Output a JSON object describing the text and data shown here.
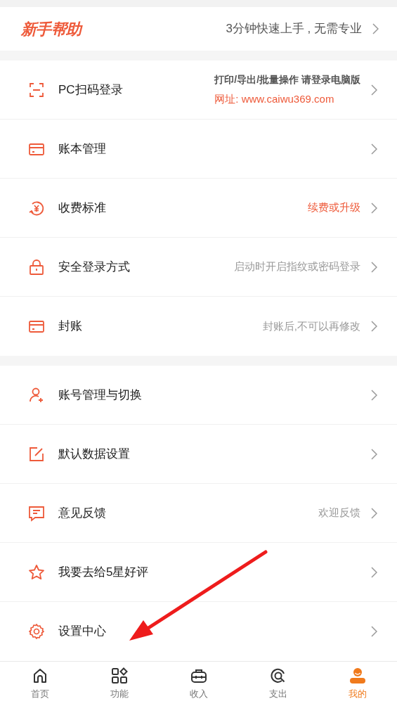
{
  "help_banner": {
    "title": "新手帮助",
    "subtitle": "3分钟快速上手 , 无需专业"
  },
  "sections": [
    {
      "items": [
        {
          "label": "PC扫码登录",
          "hints": [
            {
              "text": "打印/导出/批量操作 请登录电脑版",
              "kind": "bold"
            },
            {
              "text": "网址: www.caiwu369.com",
              "kind": "accent"
            }
          ]
        },
        {
          "label": "账本管理"
        },
        {
          "label": "收费标准",
          "hints": [
            {
              "text": "续费或升级",
              "kind": "accent"
            }
          ]
        },
        {
          "label": "安全登录方式",
          "hints": [
            {
              "text": "启动时开启指纹或密码登录",
              "kind": "muted"
            }
          ]
        },
        {
          "label": "封账",
          "hints": [
            {
              "text": "封账后,不可以再修改",
              "kind": "muted"
            }
          ]
        }
      ]
    },
    {
      "items": [
        {
          "label": "账号管理与切换"
        },
        {
          "label": "默认数据设置"
        },
        {
          "label": "意见反馈",
          "hints": [
            {
              "text": "欢迎反馈",
              "kind": "muted"
            }
          ]
        },
        {
          "label": "我要去给5星好评"
        },
        {
          "label": "设置中心"
        }
      ]
    }
  ],
  "tab_bar": [
    {
      "label": "首页",
      "selected": false
    },
    {
      "label": "功能",
      "selected": false
    },
    {
      "label": "收入",
      "selected": false
    },
    {
      "label": "支出",
      "selected": false
    },
    {
      "label": "我的",
      "selected": true
    }
  ]
}
